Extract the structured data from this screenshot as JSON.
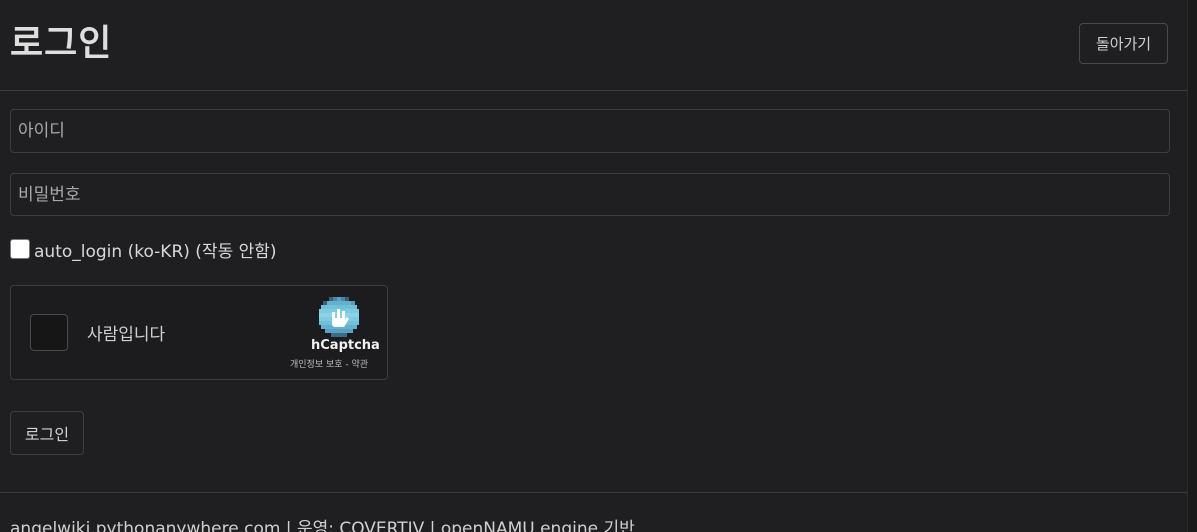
{
  "header": {
    "title": "로그인",
    "back_label": "돌아가기"
  },
  "form": {
    "id_placeholder": "아이디",
    "password_placeholder": "비밀번호",
    "auto_login_label": "auto_login (ko-KR) (작동 안함)",
    "submit_label": "로그인"
  },
  "captcha": {
    "label": "사람입니다",
    "brand": "hCaptcha",
    "links": "개인정보 보호 - 약관",
    "logo_icon": "hcaptcha-logo-icon"
  },
  "footer": {
    "text": "angelwiki.pythonanywhere.com | 운영: COVERTIV | openNAMU engine 기반"
  }
}
